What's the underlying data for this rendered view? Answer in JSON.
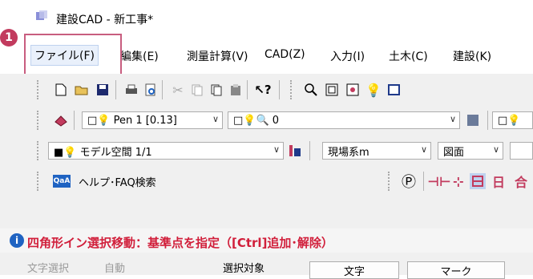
{
  "window": {
    "title": "建設CAD - 新工事*"
  },
  "callout": {
    "number": "1"
  },
  "menu": {
    "items": [
      "ファイル(F)",
      "編集(E)",
      "測量計算(V)",
      "CAD(Z)",
      "入力(I)",
      "土木(C)",
      "建設(K)"
    ]
  },
  "toolbar": {
    "pen_combo": "□💡 Pen 1 [0.13]",
    "layer_combo": "□💡🔍 0",
    "layer2_combo": "□💡",
    "view_combo": "■💡 モデル空間 1/1",
    "coord_combo": "現場系m",
    "drawing_combo": "図面",
    "help_label": "ヘルプ･FAQ検索",
    "help_badge": "QaA"
  },
  "status": {
    "info": "i",
    "message": "四角形イン選択移動：基準点を指定（[Ctrl]追加･解除）"
  },
  "bottom": {
    "text_select_label": "文字選択",
    "auto_value": "自動",
    "target_label": "選択対象",
    "text_button": "文字",
    "mark_button": "マーク"
  },
  "colors": {
    "callout": "#c23b5e",
    "status_text": "#d11f3b",
    "info_icon": "#1f63c2"
  }
}
